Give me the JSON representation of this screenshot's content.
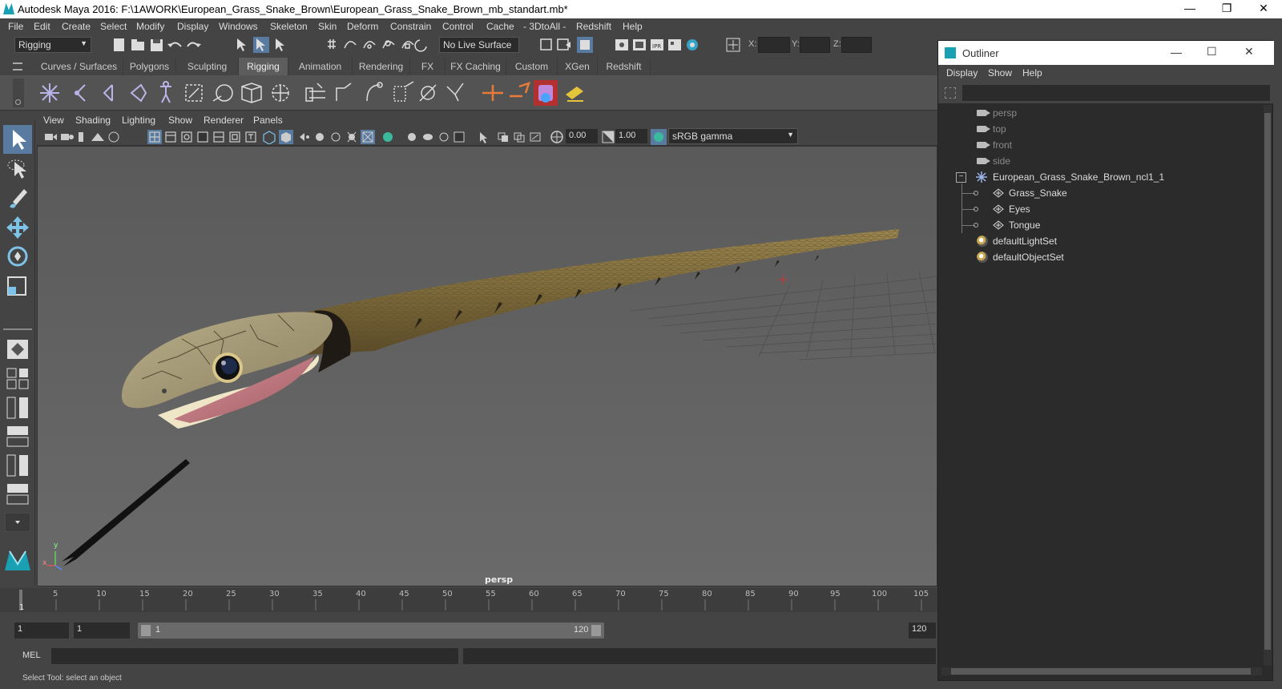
{
  "window": {
    "title": "Autodesk Maya 2016: F:\\1AWORK\\European_Grass_Snake_Brown\\European_Grass_Snake_Brown_mb_standart.mb*",
    "minimize": "—",
    "restore": "❐",
    "close": "✕"
  },
  "menubar": [
    "File",
    "Edit",
    "Create",
    "Select",
    "Modify",
    "Display",
    "Windows",
    "Skeleton",
    "Skin",
    "Deform",
    "Constrain",
    "Control",
    "Cache",
    "- 3DtoAll -",
    "Redshift",
    "Help"
  ],
  "statusline": {
    "mode": "Rigging",
    "live_surface": "No Live Surface",
    "x_label": "X:",
    "y_label": "Y:",
    "z_label": "Z:"
  },
  "shelf_tabs": [
    {
      "label": "Curves / Surfaces",
      "active": false
    },
    {
      "label": "Polygons",
      "active": false
    },
    {
      "label": "Sculpting",
      "active": false
    },
    {
      "label": "Rigging",
      "active": true
    },
    {
      "label": "Animation",
      "active": false
    },
    {
      "label": "Rendering",
      "active": false
    },
    {
      "label": "FX",
      "active": false
    },
    {
      "label": "FX Caching",
      "active": false
    },
    {
      "label": "Custom",
      "active": false
    },
    {
      "label": "XGen",
      "active": false
    },
    {
      "label": "Redshift",
      "active": false
    }
  ],
  "panel_menu": [
    "View",
    "Shading",
    "Lighting",
    "Show",
    "Renderer",
    "Panels"
  ],
  "panel_toolbar": {
    "exposure": "0.00",
    "gamma": "1.00",
    "color_space": "sRGB gamma"
  },
  "viewport": {
    "camera_label": "persp",
    "axis_x": "x",
    "axis_y": "y"
  },
  "timeline": {
    "ticks": [
      "5",
      "10",
      "15",
      "20",
      "25",
      "30",
      "35",
      "40",
      "45",
      "50",
      "55",
      "60",
      "65",
      "70",
      "75",
      "80",
      "85",
      "90",
      "95",
      "100",
      "105"
    ],
    "current_frame": "1"
  },
  "range": {
    "start": "1",
    "playback_start": "1",
    "slider_start": "1",
    "slider_end": "120",
    "end": "120"
  },
  "mel_label": "MEL",
  "help_line": "Select Tool: select an object",
  "outliner": {
    "title": "Outliner",
    "menu": [
      "Display",
      "Show",
      "Help"
    ],
    "items": [
      {
        "label": "persp",
        "kind": "camera",
        "indent": 0
      },
      {
        "label": "top",
        "kind": "camera",
        "indent": 0
      },
      {
        "label": "front",
        "kind": "camera",
        "indent": 0
      },
      {
        "label": "side",
        "kind": "camera",
        "indent": 0
      },
      {
        "label": "European_Grass_Snake_Brown_ncl1_1",
        "kind": "group",
        "indent": 0
      },
      {
        "label": "Grass_Snake",
        "kind": "mesh",
        "indent": 1
      },
      {
        "label": "Eyes",
        "kind": "mesh",
        "indent": 1
      },
      {
        "label": "Tongue",
        "kind": "mesh",
        "indent": 1
      },
      {
        "label": "defaultLightSet",
        "kind": "set",
        "indent": 0
      },
      {
        "label": "defaultObjectSet",
        "kind": "set",
        "indent": 0
      }
    ]
  },
  "colors": {
    "accent": "#1aa0b5",
    "active_tab": "#5d5d5d",
    "snake_body": "#7d6a3a",
    "mouth": "#c77d85"
  }
}
